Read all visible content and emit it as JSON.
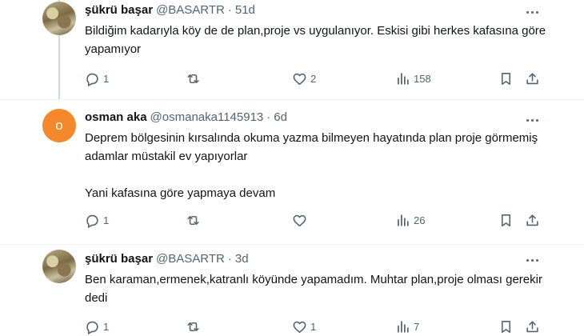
{
  "tweets": [
    {
      "name": "şükrü başar",
      "handle": "@BASARTR",
      "dot": "·",
      "time": "51d",
      "avatar_type": "photo",
      "avatar_letter": "",
      "text": [
        "Bildiğim kadarıyla köy de de plan,proje vs uygulanıyor. Eskisi gibi herkes kafasına göre yapamıyor"
      ],
      "replies": "1",
      "retweets": "",
      "likes": "2",
      "views": "158"
    },
    {
      "name": "osman aka",
      "handle": "@osmanaka1145913",
      "dot": "·",
      "time": "6d",
      "avatar_type": "letter",
      "avatar_letter": "o",
      "text": [
        "Deprem bölgesinin kırsalında okuma yazma bilmeyen hayatında plan proje görmemiş adamlar müstakil ev yapıyorlar",
        "Yani kafasına göre yapmaya devam"
      ],
      "replies": "1",
      "retweets": "",
      "likes": "",
      "views": "26"
    },
    {
      "name": "şükrü başar",
      "handle": "@BASARTR",
      "dot": "·",
      "time": "3d",
      "avatar_type": "photo",
      "avatar_letter": "",
      "text": [
        "Ben karaman,ermenek,katranlı köyünde yapamadım. Muhtar plan,proje olması gerekir dedi"
      ],
      "replies": "1",
      "retweets": "",
      "likes": "1",
      "views": "7"
    }
  ],
  "colors": {
    "text": "#0f1419",
    "secondary": "#536471",
    "avatar_orange": "#f4882b",
    "divider": "#eff3f4"
  },
  "icons": [
    "reply-icon",
    "retweet-icon",
    "like-icon",
    "views-icon",
    "bookmark-icon",
    "share-icon",
    "more-icon"
  ]
}
